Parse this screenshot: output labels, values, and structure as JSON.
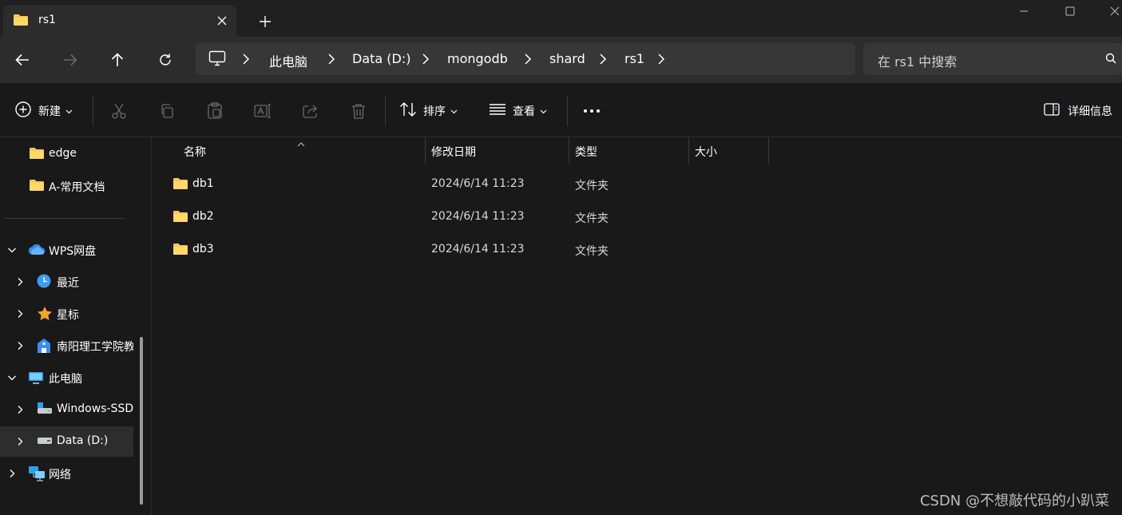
{
  "window": {
    "tab_title": "rs1",
    "tab_icon": "folder-icon"
  },
  "nav": {
    "back_icon": "arrow-left-icon",
    "forward_icon": "arrow-right-icon",
    "up_icon": "arrow-up-icon",
    "refresh_icon": "refresh-icon"
  },
  "address": {
    "crumbs": [
      "此电脑",
      "Data (D:)",
      "mongodb",
      "shard",
      "rs1"
    ]
  },
  "search": {
    "placeholder": "在 rs1 中搜索"
  },
  "toolbar": {
    "new_label": "新建",
    "sort_label": "排序",
    "view_label": "查看",
    "details_label": "详细信息"
  },
  "sidebar": {
    "quick_items": [
      {
        "label": "edge",
        "icon": "folder-icon"
      },
      {
        "label": "A-常用文档",
        "icon": "folder-icon"
      }
    ],
    "tree": [
      {
        "label": "WPS网盘",
        "icon": "cloud-icon",
        "expanded": true
      },
      {
        "label": "最近",
        "icon": "clock-icon"
      },
      {
        "label": "星标",
        "icon": "star-icon"
      },
      {
        "label": "南阳理工学院教",
        "icon": "building-icon"
      },
      {
        "label": "此电脑",
        "icon": "pc-icon",
        "expanded": true
      },
      {
        "label": "Windows-SSD",
        "icon": "drive-icon"
      },
      {
        "label": "Data (D:)",
        "icon": "drive-icon",
        "selected": true
      },
      {
        "label": "网络",
        "icon": "network-icon"
      }
    ]
  },
  "columns": {
    "name": "名称",
    "modified": "修改日期",
    "type": "类型",
    "size": "大小"
  },
  "files": [
    {
      "name": "db1",
      "modified": "2024/6/14 11:23",
      "type": "文件夹",
      "size": ""
    },
    {
      "name": "db2",
      "modified": "2024/6/14 11:23",
      "type": "文件夹",
      "size": ""
    },
    {
      "name": "db3",
      "modified": "2024/6/14 11:23",
      "type": "文件夹",
      "size": ""
    }
  ],
  "watermark": "CSDN @不想敲代码的小趴菜",
  "colors": {
    "folder": "#f8c94f",
    "accent": "#4cc2ff"
  }
}
